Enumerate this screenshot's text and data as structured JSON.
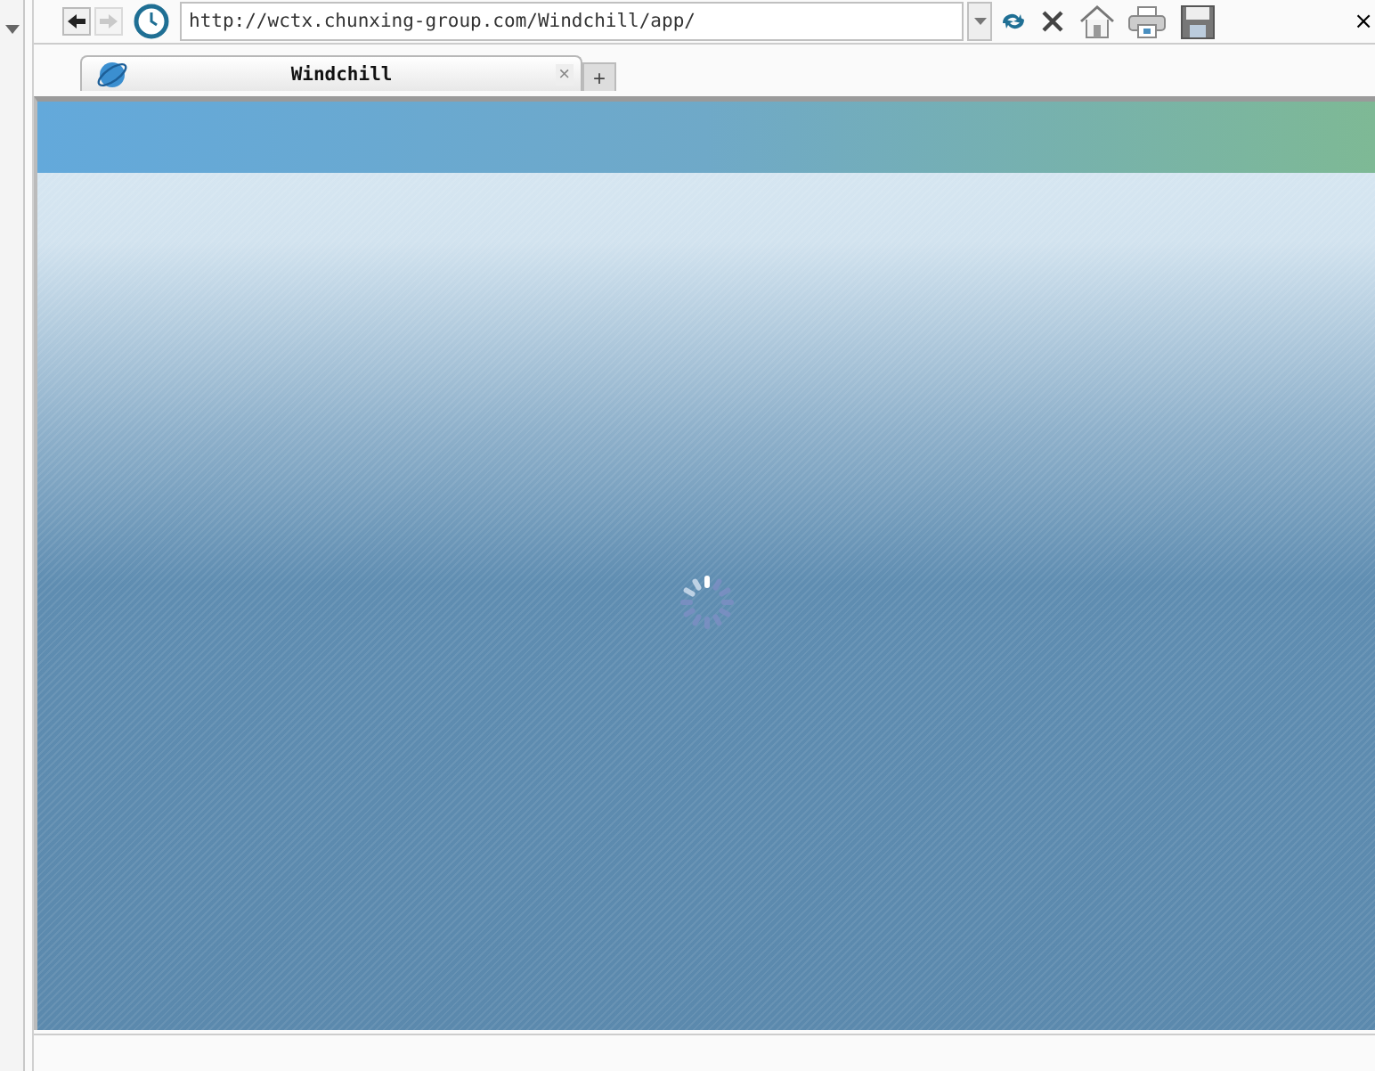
{
  "toolbar": {
    "url": "http://wctx.chunxing-group.com/Windchill/app/",
    "corner_close": "×"
  },
  "tabs": [
    {
      "title": "Windchill",
      "close": "×",
      "selected": true
    }
  ],
  "new_tab": "+",
  "page": {
    "loading": true
  }
}
